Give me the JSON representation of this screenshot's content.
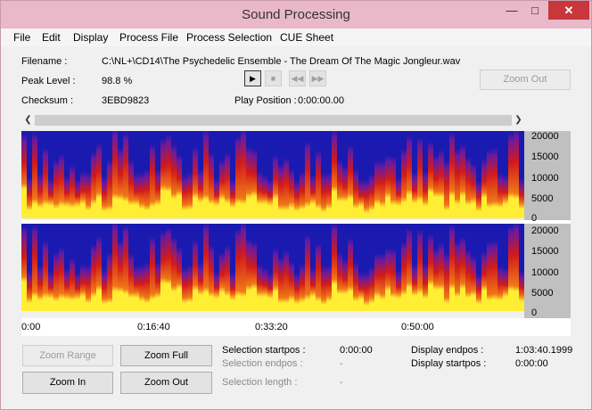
{
  "window": {
    "title": "Sound Processing",
    "minimize_label": "—",
    "maximize_label": "□",
    "close_label": "✕"
  },
  "menu": {
    "items": [
      "File",
      "Edit",
      "Display",
      "Process File",
      "Process Selection",
      "CUE Sheet"
    ]
  },
  "info": {
    "filename_label": "Filename :",
    "filename_value": "C:\\NL+\\CD14\\The Psychedelic Ensemble - The Dream Of The Magic Jongleur.wav",
    "peak_label": "Peak Level :",
    "peak_value": "98.8 %",
    "checksum_label": "Checksum :",
    "checksum_value": "3EBD9823",
    "play_position_label": "Play Position :",
    "play_position_value": "0:00:00.00"
  },
  "transport": {
    "play_icon": "play-icon",
    "stop_icon": "stop-icon",
    "rewind_icon": "rewind-icon",
    "forward_icon": "fast-forward-icon"
  },
  "buttons": {
    "zoom_out_top": "Zoom Out",
    "zoom_range": "Zoom Range",
    "zoom_full": "Zoom Full",
    "zoom_in": "Zoom In",
    "zoom_out": "Zoom Out"
  },
  "spectrogram": {
    "y_ticks": [
      "20000",
      "15000",
      "10000",
      "5000",
      "0"
    ],
    "x_ticks": [
      "0:00",
      "0:16:40",
      "0:33:20",
      "0:50:00"
    ],
    "colors": {
      "low": "#1a1ab0",
      "mid": "#d21a1a",
      "high": "#ffee33"
    }
  },
  "selection": {
    "startpos_label": "Selection startpos :",
    "startpos_value": "0:00:00",
    "endpos_label": "Selection endpos :",
    "endpos_value": "-",
    "length_label": "Selection length :",
    "length_value": "-",
    "display_endpos_label": "Display endpos :",
    "display_endpos_value": "1:03:40.1999",
    "display_startpos_label": "Display startpos :",
    "display_startpos_value": "0:00:00"
  }
}
